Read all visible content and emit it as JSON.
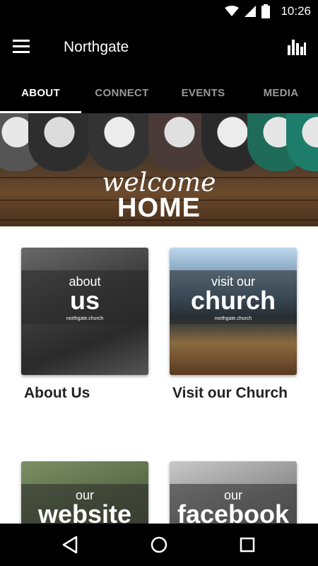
{
  "status_bar": {
    "time": "10:26",
    "icons": [
      "wifi-icon",
      "cell-signal-icon",
      "battery-icon"
    ]
  },
  "app_bar": {
    "title": "Northgate",
    "menu_icon": "hamburger-menu-icon",
    "action_icon": "bar-chart-icon"
  },
  "tabs": [
    {
      "label": "ABOUT",
      "active": true
    },
    {
      "label": "CONNECT",
      "active": false
    },
    {
      "label": "EVENTS",
      "active": false
    },
    {
      "label": "MEDIA",
      "active": false
    }
  ],
  "banner": {
    "line1": "welcome",
    "line2": "HOME"
  },
  "cards": [
    {
      "small": "about",
      "big": "us",
      "brand": "northgate.church",
      "label": "About Us"
    },
    {
      "small": "visit our",
      "big": "church",
      "brand": "northgate.church",
      "label": "Visit our Church"
    },
    {
      "small": "our",
      "big": "website",
      "label": ""
    },
    {
      "small": "our",
      "big": "facebook",
      "label": ""
    }
  ],
  "nav_bar": {
    "buttons": [
      "back-icon",
      "home-icon",
      "recents-icon"
    ]
  },
  "colors": {
    "bar_background": "#000000",
    "tab_active": "#ffffff",
    "tab_inactive": "#9a9a9a",
    "label_text": "#222222"
  }
}
